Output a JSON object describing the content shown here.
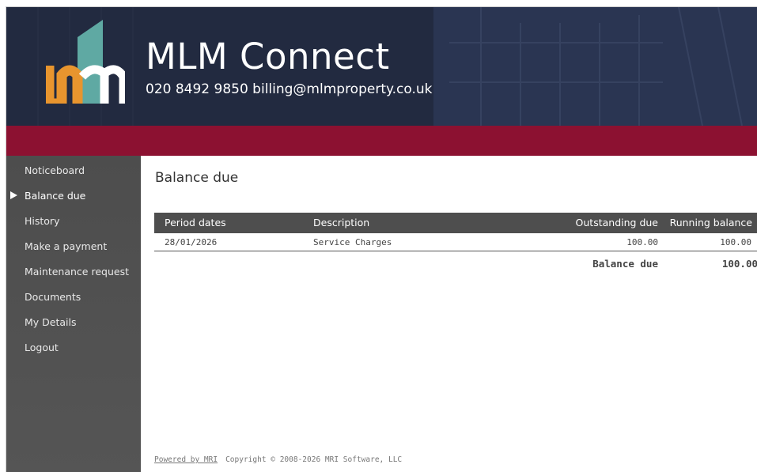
{
  "header": {
    "title": "MLM Connect",
    "contact": "020 8492 9850 billing@mlmproperty.co.uk",
    "colors": {
      "banner": "#1f273f",
      "accent_bar": "#8c1131",
      "logo_orange": "#e8952e",
      "logo_teal": "#5fa9a3"
    }
  },
  "sidebar": {
    "items": [
      {
        "label": "Noticeboard",
        "active": false
      },
      {
        "label": "Balance due",
        "active": true
      },
      {
        "label": "History",
        "active": false
      },
      {
        "label": "Make a payment",
        "active": false
      },
      {
        "label": "Maintenance request",
        "active": false
      },
      {
        "label": "Documents",
        "active": false
      },
      {
        "label": "My Details",
        "active": false
      },
      {
        "label": "Logout",
        "active": false
      }
    ]
  },
  "main": {
    "title": "Balance due",
    "table": {
      "columns": [
        "Period dates",
        "Description",
        "Outstanding due",
        "Running balance"
      ],
      "rows": [
        {
          "period": "28/01/2026",
          "description": "Service Charges",
          "outstanding": "100.00",
          "running": "100.00"
        }
      ],
      "total_label": "Balance due",
      "total_value": "100.00"
    }
  },
  "footer": {
    "link": "Powered by MRI",
    "copyright": "Copyright © 2008-2026 MRI Software, LLC"
  }
}
